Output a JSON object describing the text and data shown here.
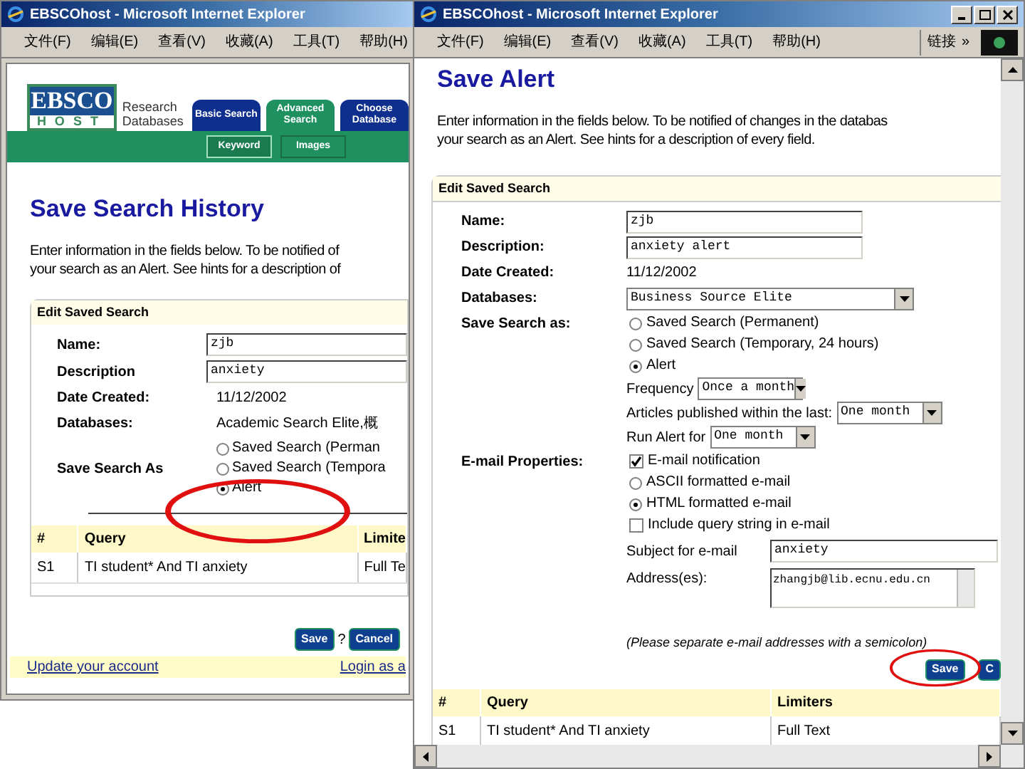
{
  "left_window": {
    "title": "EBSCOhost - Microsoft Internet Explorer",
    "menu": [
      "文件(F)",
      "编辑(E)",
      "查看(V)",
      "收藏(A)",
      "工具(T)",
      "帮助(H)"
    ],
    "logo": {
      "top": "EBSCO",
      "bottom": "HOST",
      "tagline": [
        "Research",
        "Databases"
      ]
    },
    "tabs": [
      {
        "label": "Basic Search",
        "selected": false
      },
      {
        "label": "Advanced Search",
        "selected": true
      },
      {
        "label": "Choose Database",
        "selected": false
      }
    ],
    "subtabs": [
      {
        "label": "Keyword",
        "selected": true
      },
      {
        "label": "Images",
        "selected": false
      }
    ],
    "heading": "Save Search History",
    "intro": [
      "Enter information in the fields below. To be notified of",
      "your search as an Alert. See hints for a description of"
    ],
    "section_title": "Edit Saved Search",
    "fields": [
      {
        "kind": "input",
        "label": "Name:",
        "value": "zjb"
      },
      {
        "kind": "input",
        "label": "Description",
        "value": "anxiety"
      },
      {
        "kind": "text",
        "label": "Date Created:",
        "value": "11/12/2002"
      },
      {
        "kind": "text",
        "label": "Databases:",
        "value": "Academic Search Elite,概"
      },
      {
        "kind": "radios",
        "label": "Save Search As",
        "options": [
          {
            "label": "Saved Search (Perman",
            "selected": false
          },
          {
            "label": "Saved Search (Tempora",
            "selected": false
          },
          {
            "label": "Alert",
            "selected": true
          }
        ]
      }
    ],
    "table": {
      "columns": [
        "#",
        "Query",
        "Limite"
      ],
      "rows": [
        [
          "S1",
          "TI student* And TI anxiety",
          "Full Te"
        ]
      ]
    },
    "buttons": [
      {
        "kind": "button",
        "label": "Save"
      },
      {
        "kind": "help",
        "label": "?"
      },
      {
        "kind": "button",
        "label": "Cancel"
      }
    ],
    "footer_links": [
      "Update your account",
      "Login as a"
    ]
  },
  "right_window": {
    "title": "EBSCOhost - Microsoft Internet Explorer",
    "menu": [
      "文件(F)",
      "编辑(E)",
      "查看(V)",
      "收藏(A)",
      "工具(T)",
      "帮助(H)"
    ],
    "links": "链接",
    "chevron": "»",
    "heading": "Save Alert",
    "intro": [
      "Enter information in the fields below. To be notified of changes in the databas",
      "your search as an Alert. See hints for a description of every field."
    ],
    "section_title": "Edit Saved Search",
    "fields": [
      {
        "kind": "input",
        "label": "Name:",
        "value": "zjb"
      },
      {
        "kind": "input",
        "label": "Description:",
        "value": "anxiety alert"
      },
      {
        "kind": "text",
        "label": "Date Created:",
        "value": "11/12/2002"
      },
      {
        "kind": "select",
        "label": "Databases:",
        "value": "Business Source Elite"
      },
      {
        "kind": "options",
        "label": "Save Search as:",
        "options": [
          {
            "kind": "radio",
            "label": "Saved Search (Permanent)",
            "selected": false
          },
          {
            "kind": "radio",
            "label": "Saved Search (Temporary, 24 hours)",
            "selected": false
          },
          {
            "kind": "radio",
            "label": "Alert",
            "selected": true
          },
          {
            "kind": "select",
            "label": "Frequency",
            "value": "Once a month"
          },
          {
            "kind": "select",
            "label": "Articles published within the last:",
            "value": "One month"
          },
          {
            "kind": "select",
            "label": "Run Alert for",
            "value": "One month"
          }
        ]
      },
      {
        "kind": "options",
        "label": "E-mail Properties:",
        "options": [
          {
            "kind": "checkbox",
            "label": "E-mail notification",
            "checked": true
          },
          {
            "kind": "radio",
            "label": "ASCII formatted e-mail",
            "selected": false
          },
          {
            "kind": "radio",
            "label": "HTML formatted e-mail",
            "selected": true
          },
          {
            "kind": "checkbox",
            "label": "Include query string in e-mail",
            "checked": false
          },
          {
            "kind": "input",
            "label": "Subject for e-mail",
            "value": "anxiety"
          },
          {
            "kind": "textarea",
            "label": "Address(es):",
            "value": "zhangjb@lib.ecnu.edu.cn"
          }
        ]
      }
    ],
    "note": "(Please separate e-mail addresses with a semicolon)",
    "buttons": [
      {
        "kind": "button",
        "label": "Save"
      },
      {
        "kind": "button",
        "label": "C"
      }
    ],
    "table": {
      "columns": [
        "#",
        "Query",
        "Limiters"
      ],
      "rows": [
        [
          "S1",
          "TI student* And TI anxiety",
          "Full Text"
        ]
      ]
    }
  }
}
